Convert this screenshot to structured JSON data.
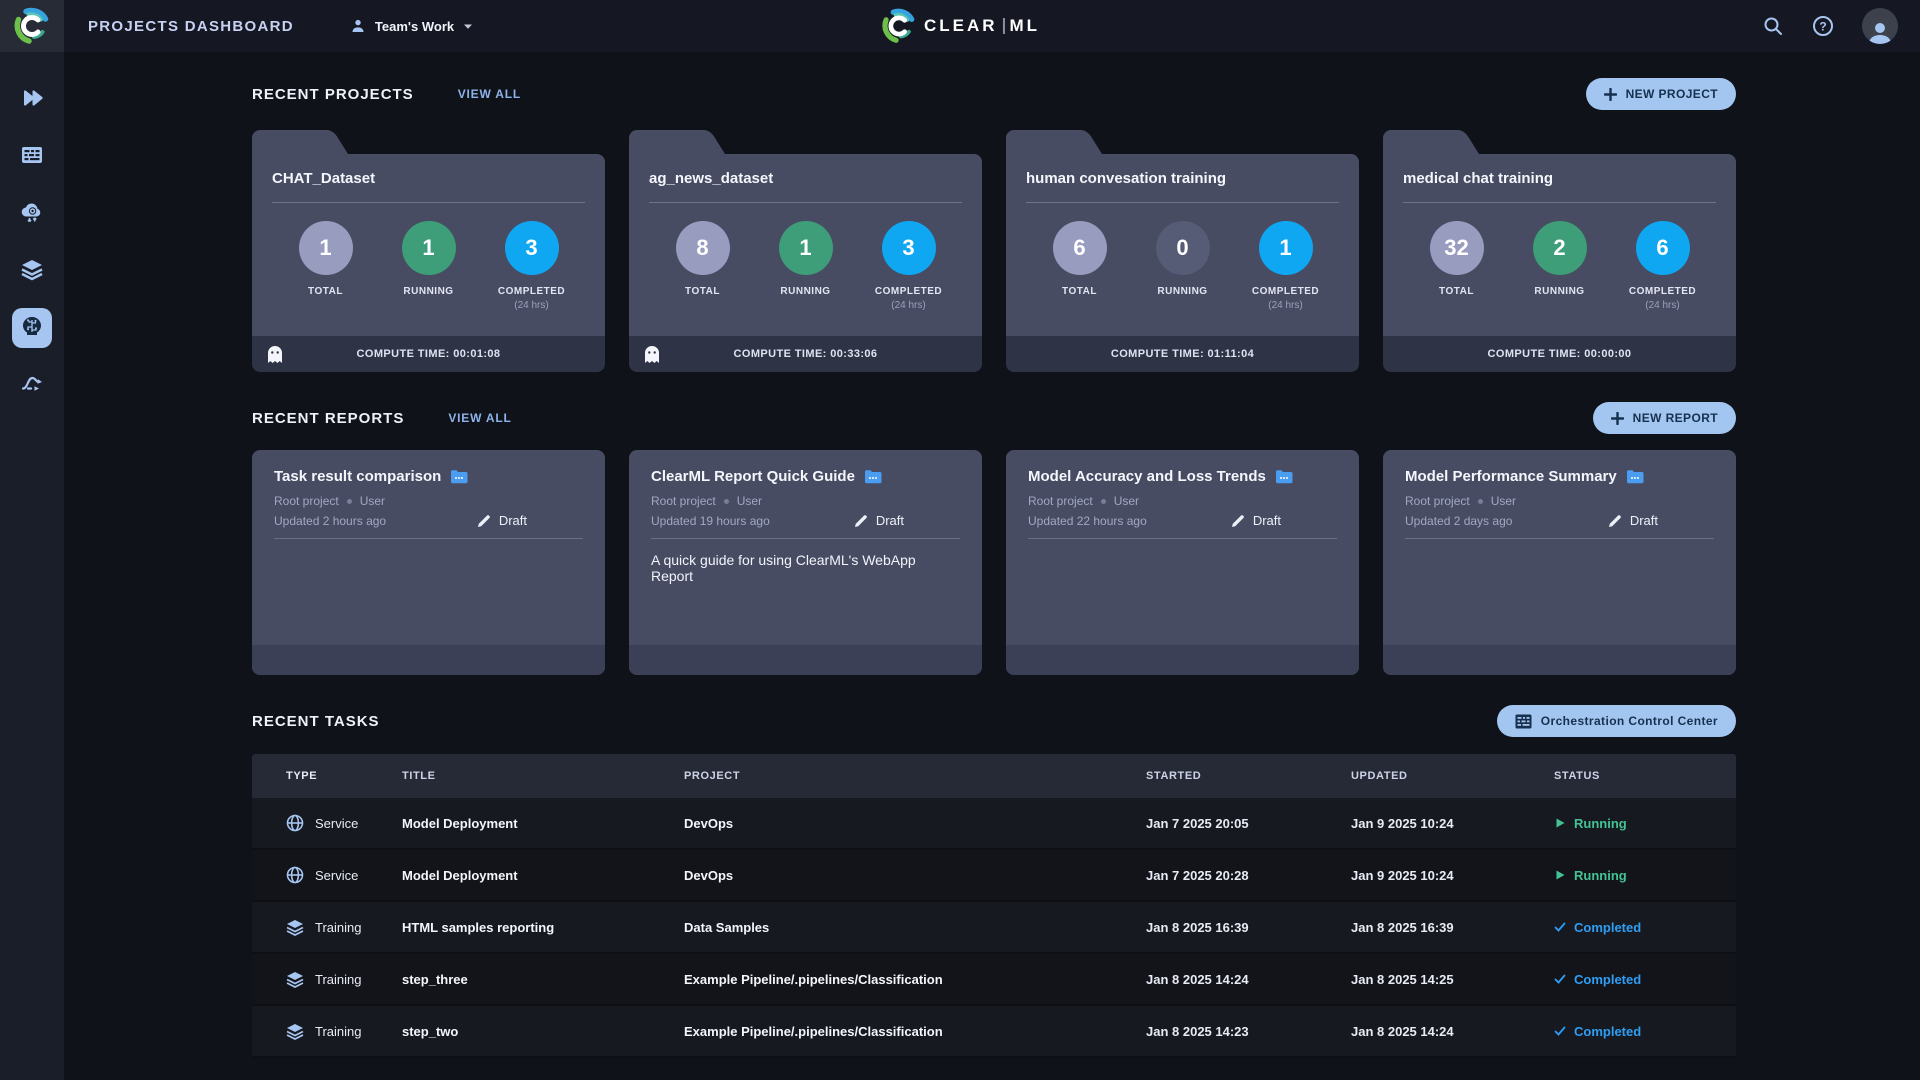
{
  "topbar": {
    "page_title": "PROJECTS DASHBOARD",
    "workspace_name": "Team's Work",
    "brand_clear": "CLEAR",
    "brand_ml": "ML"
  },
  "sidebar": {
    "items": [
      {
        "icon": "projects-icon",
        "active": false
      },
      {
        "icon": "workers-queues-icon",
        "active": false
      },
      {
        "icon": "autoscaler-cloud-icon",
        "active": false
      },
      {
        "icon": "datasets-layers-icon",
        "active": false
      },
      {
        "icon": "model-brain-icon",
        "active": true
      },
      {
        "icon": "pipelines-icon",
        "active": false
      }
    ]
  },
  "colors": {
    "accent_light_blue": "#a3c6f1",
    "running_green": "#43c394",
    "completed_blue": "#2f9ef5",
    "total_circle": "#989dc0",
    "running_circle": "#3d9e79",
    "zero_circle": "#565b76",
    "completed_circle": "#0fa7f2"
  },
  "projects_section": {
    "title": "RECENT PROJECTS",
    "view_all": "VIEW ALL",
    "new_button": "NEW PROJECT",
    "compute_label": "COMPUTE TIME:",
    "cards": [
      {
        "name": "CHAT_Dataset",
        "ghost": true,
        "compute_time": "00:01:08",
        "stats": [
          {
            "value": "1",
            "label": "TOTAL",
            "sublabel": "",
            "color": "#989dc0"
          },
          {
            "value": "1",
            "label": "RUNNING",
            "sublabel": "",
            "color": "#3d9e79"
          },
          {
            "value": "3",
            "label": "COMPLETED",
            "sublabel": "(24 hrs)",
            "color": "#0fa7f2"
          }
        ]
      },
      {
        "name": "ag_news_dataset",
        "ghost": true,
        "compute_time": "00:33:06",
        "stats": [
          {
            "value": "8",
            "label": "TOTAL",
            "sublabel": "",
            "color": "#989dc0"
          },
          {
            "value": "1",
            "label": "RUNNING",
            "sublabel": "",
            "color": "#3d9e79"
          },
          {
            "value": "3",
            "label": "COMPLETED",
            "sublabel": "(24 hrs)",
            "color": "#0fa7f2"
          }
        ]
      },
      {
        "name": "human convesation training",
        "ghost": false,
        "compute_time": "01:11:04",
        "stats": [
          {
            "value": "6",
            "label": "TOTAL",
            "sublabel": "",
            "color": "#989dc0"
          },
          {
            "value": "0",
            "label": "RUNNING",
            "sublabel": "",
            "color": "#565b76"
          },
          {
            "value": "1",
            "label": "COMPLETED",
            "sublabel": "(24 hrs)",
            "color": "#0fa7f2"
          }
        ]
      },
      {
        "name": "medical chat training",
        "ghost": false,
        "compute_time": "00:00:00",
        "stats": [
          {
            "value": "32",
            "label": "TOTAL",
            "sublabel": "",
            "color": "#989dc0"
          },
          {
            "value": "2",
            "label": "RUNNING",
            "sublabel": "",
            "color": "#3d9e79"
          },
          {
            "value": "6",
            "label": "COMPLETED",
            "sublabel": "(24 hrs)",
            "color": "#0fa7f2"
          }
        ]
      }
    ]
  },
  "reports_section": {
    "title": "RECENT REPORTS",
    "view_all": "VIEW ALL",
    "new_button": "NEW REPORT",
    "cards": [
      {
        "title": "Task result comparison",
        "project": "Root project",
        "author": "User",
        "updated": "Updated 2 hours ago",
        "status": "Draft",
        "description": ""
      },
      {
        "title": "ClearML Report Quick Guide",
        "project": "Root project",
        "author": "User",
        "updated": "Updated 19 hours ago",
        "status": "Draft",
        "description": "A quick guide for using ClearML's WebApp Report"
      },
      {
        "title": "Model Accuracy and Loss Trends",
        "project": "Root project",
        "author": "User",
        "updated": "Updated 22 hours ago",
        "status": "Draft",
        "description": ""
      },
      {
        "title": "Model Performance Summary",
        "project": "Root project",
        "author": "User",
        "updated": "Updated 2 days ago",
        "status": "Draft",
        "description": ""
      }
    ]
  },
  "tasks_section": {
    "title": "RECENT TASKS",
    "orchestration_button": "Orchestration Control Center",
    "columns": [
      "TYPE",
      "TITLE",
      "PROJECT",
      "STARTED",
      "UPDATED",
      "STATUS"
    ],
    "rows": [
      {
        "type": "Service",
        "type_icon": "globe-icon",
        "title": "Model Deployment",
        "project": "DevOps",
        "started": "Jan 7 2025 20:05",
        "updated": "Jan 9 2025 10:24",
        "status": "Running",
        "status_icon": "play-icon",
        "status_color": "#43c394"
      },
      {
        "type": "Service",
        "type_icon": "globe-icon",
        "title": "Model Deployment",
        "project": "DevOps",
        "started": "Jan 7 2025 20:28",
        "updated": "Jan 9 2025 10:24",
        "status": "Running",
        "status_icon": "play-icon",
        "status_color": "#43c394"
      },
      {
        "type": "Training",
        "type_icon": "layers-icon",
        "title": "HTML samples reporting",
        "project": "Data Samples",
        "started": "Jan 8 2025 16:39",
        "updated": "Jan 8 2025 16:39",
        "status": "Completed",
        "status_icon": "check-icon",
        "status_color": "#2f9ef5"
      },
      {
        "type": "Training",
        "type_icon": "layers-icon",
        "title": "step_three",
        "project": "Example Pipeline/.pipelines/Classification",
        "started": "Jan 8 2025 14:24",
        "updated": "Jan 8 2025 14:25",
        "status": "Completed",
        "status_icon": "check-icon",
        "status_color": "#2f9ef5"
      },
      {
        "type": "Training",
        "type_icon": "layers-icon",
        "title": "step_two",
        "project": "Example Pipeline/.pipelines/Classification",
        "started": "Jan 8 2025 14:23",
        "updated": "Jan 8 2025 14:24",
        "status": "Completed",
        "status_icon": "check-icon",
        "status_color": "#2f9ef5"
      }
    ]
  }
}
